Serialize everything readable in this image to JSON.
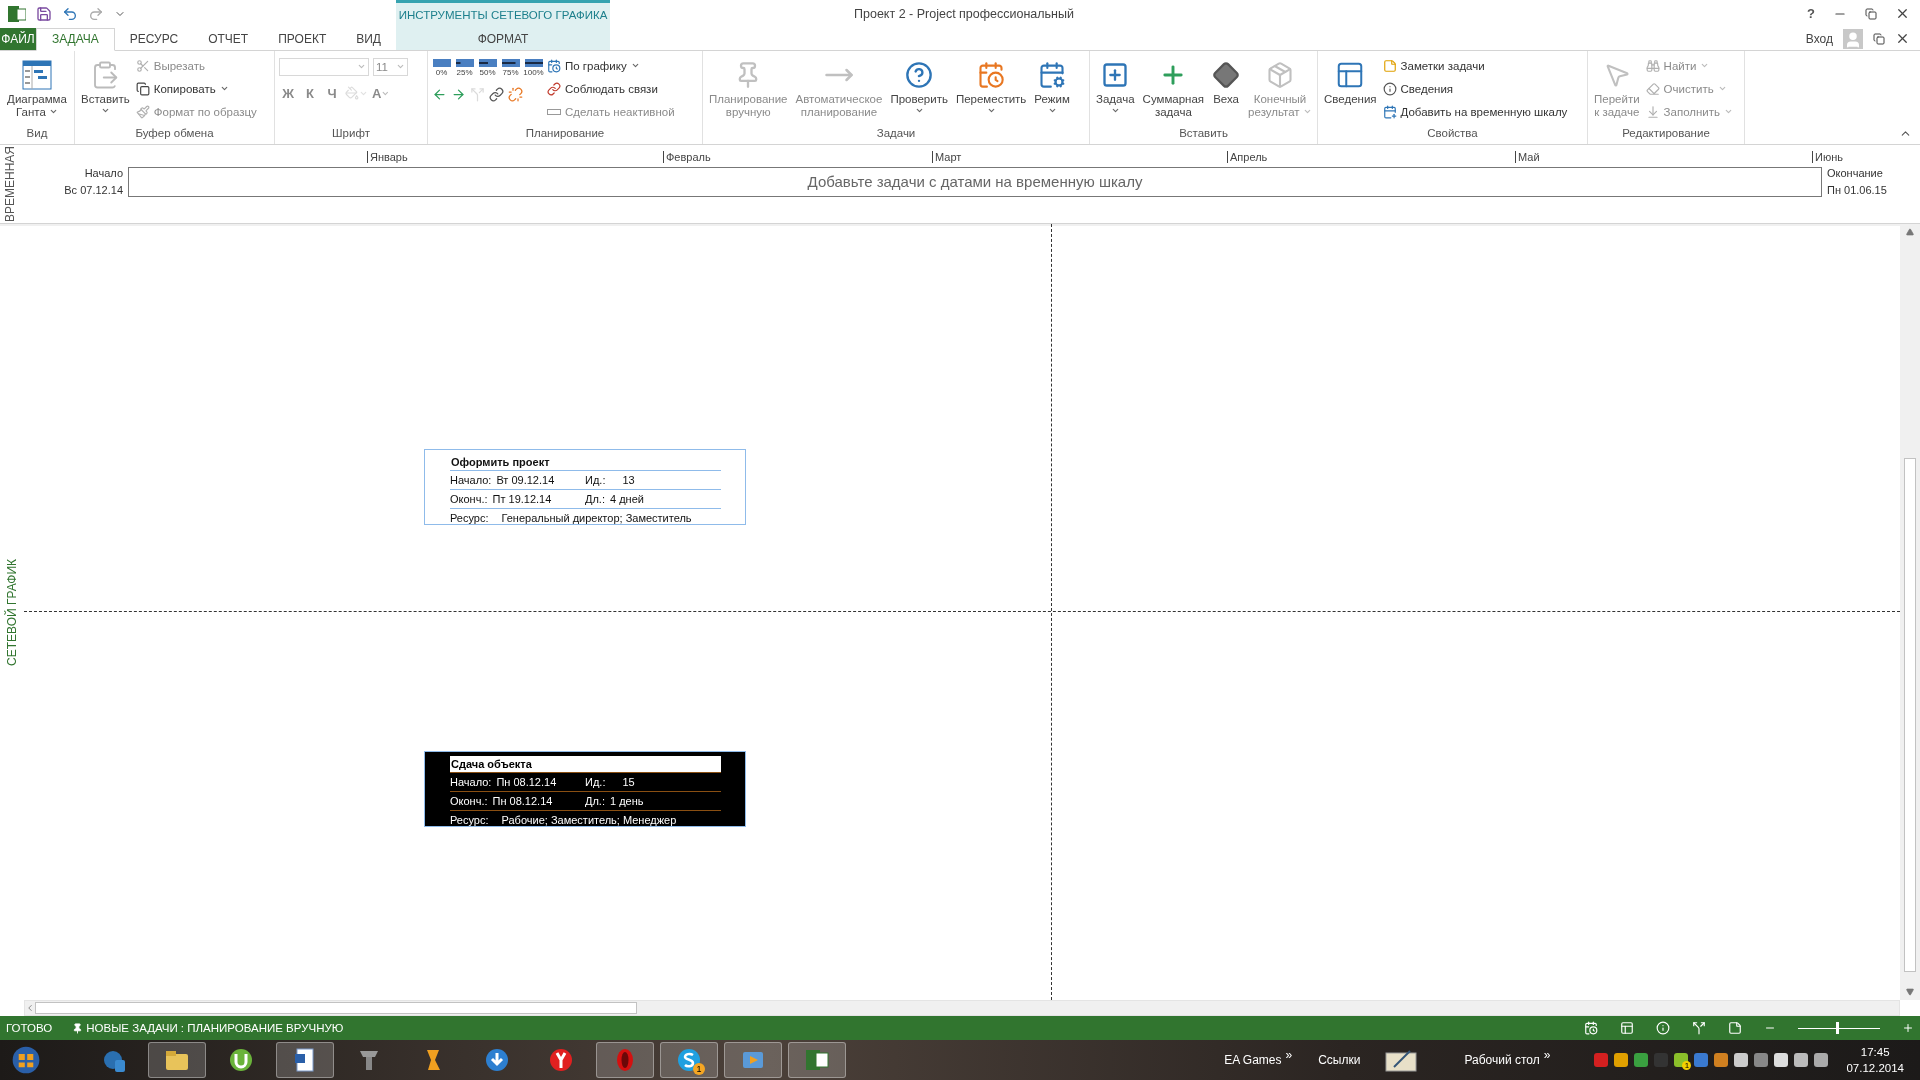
{
  "title_bar": {
    "title": "Проект 2 - Project профессиональный",
    "help": "?",
    "sign_in": "Вход"
  },
  "contextual_group": "ИНСТРУМЕНТЫ СЕТЕВОГО ГРАФИКА",
  "tabs": [
    {
      "label": "ФАЙЛ",
      "kind": "file",
      "selected": false
    },
    {
      "label": "ЗАДАЧА",
      "kind": "tab",
      "selected": true
    },
    {
      "label": "РЕСУРС",
      "kind": "tab",
      "selected": false
    },
    {
      "label": "ОТЧЕТ",
      "kind": "tab",
      "selected": false
    },
    {
      "label": "ПРОЕКТ",
      "kind": "tab",
      "selected": false
    },
    {
      "label": "ВИД",
      "kind": "tab",
      "selected": false
    },
    {
      "label": "ФОРМАТ",
      "kind": "contextual",
      "selected": false
    }
  ],
  "ribbon_groups": [
    {
      "label": "Вид",
      "items": [
        {
          "kind": "large",
          "lines": [
            "Диаграмма",
            "Ганта"
          ],
          "dropdown": true,
          "disabled": false
        }
      ]
    },
    {
      "label": "Буфер обмена",
      "items": [
        {
          "kind": "large",
          "lines": [
            "Вставить"
          ],
          "dropdown": true,
          "disabled": false
        },
        {
          "kind": "small",
          "label": "Вырезать",
          "disabled": true
        },
        {
          "kind": "small",
          "label": "Копировать",
          "dropdown": true,
          "disabled": false
        },
        {
          "kind": "small",
          "label": "Формат по образцу",
          "disabled": true
        }
      ]
    },
    {
      "label": "Шрифт",
      "items": [
        {
          "kind": "combo",
          "dropdown": true,
          "disabled": true
        },
        {
          "kind": "combo",
          "label": "11",
          "dropdown": true,
          "disabled": true
        },
        {
          "kind": "glyph",
          "label": "Ж",
          "disabled": true
        },
        {
          "kind": "glyph",
          "label": "К",
          "disabled": true
        },
        {
          "kind": "glyph",
          "label": "Ч",
          "disabled": true
        },
        {
          "kind": "icon",
          "dropdown": true,
          "disabled": true
        },
        {
          "kind": "glyph",
          "label": "A",
          "dropdown": true,
          "disabled": true
        }
      ]
    },
    {
      "label": "Планирование",
      "items": [
        {
          "kind": "percent",
          "label": "0%"
        },
        {
          "kind": "percent",
          "label": "25%"
        },
        {
          "kind": "percent",
          "label": "50%"
        },
        {
          "kind": "percent",
          "label": "75%"
        },
        {
          "kind": "percent",
          "label": "100%"
        },
        {
          "kind": "icon",
          "disabled": false
        },
        {
          "kind": "icon",
          "disabled": false
        },
        {
          "kind": "icon",
          "disabled": true
        },
        {
          "kind": "icon",
          "disabled": false
        },
        {
          "kind": "icon",
          "disabled": false
        },
        {
          "kind": "small",
          "label": "По графику",
          "dropdown": true,
          "disabled": false
        },
        {
          "kind": "small",
          "label": "Соблюдать связи",
          "disabled": false
        },
        {
          "kind": "small",
          "label": "Сделать неактивной",
          "disabled": true
        }
      ]
    },
    {
      "label": "Задачи",
      "items": [
        {
          "kind": "large",
          "lines": [
            "Планирование",
            "вручную"
          ],
          "disabled": true
        },
        {
          "kind": "large",
          "lines": [
            "Автоматическое",
            "планирование"
          ],
          "disabled": true
        },
        {
          "kind": "large",
          "lines": [
            "Проверить"
          ],
          "dropdown": true,
          "disabled": false
        },
        {
          "kind": "large",
          "lines": [
            "Переместить"
          ],
          "dropdown": true,
          "disabled": false
        },
        {
          "kind": "large",
          "lines": [
            "Режим"
          ],
          "dropdown": true,
          "disabled": false
        }
      ]
    },
    {
      "label": "Вставить",
      "items": [
        {
          "kind": "large",
          "lines": [
            "Задача"
          ],
          "dropdown": true,
          "disabled": false
        },
        {
          "kind": "large",
          "lines": [
            "Суммарная",
            "задача"
          ],
          "disabled": false
        },
        {
          "kind": "large",
          "lines": [
            "Веха"
          ],
          "disabled": false
        },
        {
          "kind": "large",
          "lines": [
            "Конечный",
            "результат"
          ],
          "dropdown": true,
          "disabled": true
        }
      ]
    },
    {
      "label": "Свойства",
      "items": [
        {
          "kind": "large",
          "lines": [
            "Сведения"
          ],
          "disabled": false
        },
        {
          "kind": "small",
          "label": "Заметки задачи",
          "disabled": false
        },
        {
          "kind": "small",
          "label": "Сведения",
          "disabled": false
        },
        {
          "kind": "small",
          "label": "Добавить на временную шкалу",
          "disabled": false
        }
      ]
    },
    {
      "label": "Редактирование",
      "items": [
        {
          "kind": "large",
          "lines": [
            "Перейти",
            "к задаче"
          ],
          "disabled": true
        },
        {
          "kind": "small",
          "label": "Найти",
          "dropdown": true,
          "disabled": true
        },
        {
          "kind": "small",
          "label": "Очистить",
          "dropdown": true,
          "disabled": true
        },
        {
          "kind": "small",
          "label": "Заполнить",
          "dropdown": true,
          "disabled": true
        }
      ]
    }
  ],
  "timeline": {
    "side_label": "ВРЕМЕННАЯ",
    "start_label": "Начало",
    "start_date": "Вс 07.12.14",
    "end_label": "Окончание",
    "end_date": "Пн 01.06.15",
    "months": [
      "Январь",
      "Февраль",
      "Март",
      "Апрель",
      "Май",
      "Июнь"
    ],
    "hint": "Добавьте задачи с датами на временную шкалу"
  },
  "network": {
    "side_label": "СЕТЕВОЙ ГРАФИК",
    "nodes": [
      {
        "name": "Оформить проект",
        "start_label": "Начало:",
        "start": "Вт 09.12.14",
        "id_label": "Ид.:",
        "id": "13",
        "finish_label": "Оконч.:",
        "finish": "Пт 19.12.14",
        "duration_label": "Дл.:",
        "duration": "4 дней",
        "resource_label": "Ресурс:",
        "resources": "Генеральный директор; Заместитель",
        "selected": false
      },
      {
        "name": "Сдача объекта",
        "start_label": "Начало:",
        "start": "Пн 08.12.14",
        "id_label": "Ид.:",
        "id": "15",
        "finish_label": "Оконч.:",
        "finish": "Пн 08.12.14",
        "duration_label": "Дл.:",
        "duration": "1 день",
        "resource_label": "Ресурс:",
        "resources": "Рабочие; Заместитель; Менеджер",
        "selected": true
      }
    ]
  },
  "status_bar": {
    "ready": "ГОТОВО",
    "new_tasks": "НОВЫЕ ЗАДАЧИ : ПЛАНИРОВАНИЕ ВРУЧНУЮ",
    "zoom": {
      "level": 0.48
    }
  },
  "taskbar": {
    "skype_badge": "1",
    "toolbars": [
      "EA Games",
      "Ссылки",
      "Рабочий стол"
    ],
    "chevron": "»",
    "tray_badge": "1",
    "time": "17:45",
    "date": "07.12.2014"
  }
}
